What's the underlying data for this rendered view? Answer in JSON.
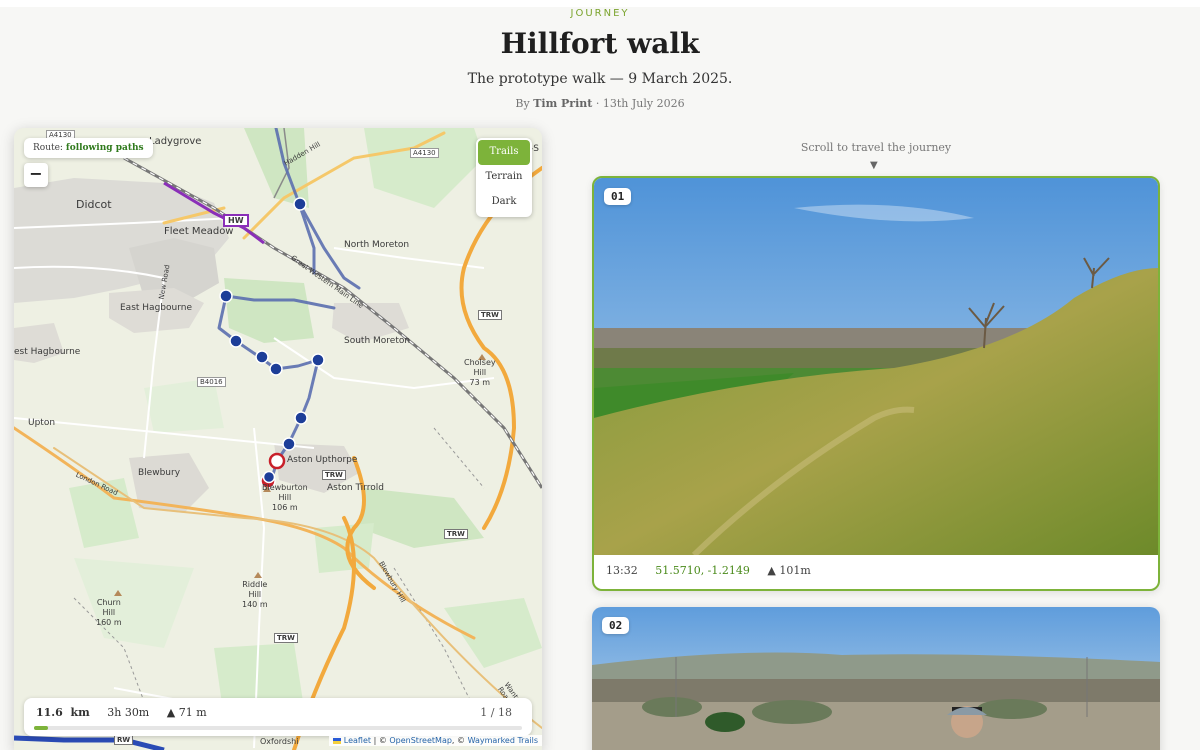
{
  "header": {
    "kicker": "JOURNEY",
    "title": "Hillfort walk",
    "subtitle": "The prototype walk — 9 March 2025.",
    "by_label": "By",
    "author": "Tim Print",
    "date": "· 13th July 2026"
  },
  "map": {
    "route_label": "Route:",
    "route_value": "following paths",
    "zoom_out": "−",
    "layers": [
      {
        "label": "Trails",
        "active": true
      },
      {
        "label": "Terrain",
        "active": false
      },
      {
        "label": "Dark",
        "active": false
      }
    ],
    "places": {
      "ladygrove": "Ladygrove",
      "didcot": "Didcot",
      "fleet_meadow": "Fleet Meadow",
      "north_moreton": "North Moreton",
      "east_hagbourne": "East Hagbourne",
      "west_hagbourne": "est Hagbourne",
      "south_moreton": "South Moreton",
      "cholsey_hill": "Cholsey",
      "cholsey_hill_2": "Hill",
      "cholsey_hill_3": "73 m",
      "upton": "Upton",
      "aston_upthorpe": "Aston Upthorpe",
      "aston_tirrold": "Aston Tirrold",
      "blewbury": "Blewbury",
      "blewburton": "Blewburton",
      "blewburton_2": "Hill",
      "blewburton_3": "106 m",
      "churn_hill": "Churn",
      "churn_hill_2": "Hill",
      "churn_hill_3": "160 m",
      "riddle_hill": "Riddle",
      "riddle_hill_2": "Hill",
      "riddle_hill_3": "140 m",
      "oxfordshire": "Oxfordshi",
      "london_road": "London Road",
      "blewbury_hill": "Blewbury Hill",
      "wantage_road": "Wantage Road",
      "new_road": "New Road",
      "great_western": "Great Western Main Line",
      "hadden_hill": "Hadden Hill",
      "a4130": "A4130",
      "a4130_2": "A4130",
      "b4016": "B4016",
      "hw": "HW",
      "trw_1": "TRW",
      "trw_2": "TRW",
      "trw_3": "TRW",
      "trw_4": "TRW",
      "rw": "RW",
      "s_edge": "-S"
    },
    "stats": {
      "distance": "11.6",
      "distance_unit": "km",
      "duration": "3h 30m",
      "ascent": "▲ 71 m",
      "counter": "1 / 18",
      "progress_fraction": 0.028
    },
    "attribution": {
      "leaflet": "Leaflet",
      "sep1": " | © ",
      "osm": "OpenStreetMap",
      "sep2": ", © ",
      "trails": "Waymarked Trails"
    }
  },
  "journey": {
    "scroll_hint": "Scroll to travel the journey",
    "arrow": "▼",
    "cards": [
      {
        "num": "01",
        "time": "13:32",
        "coords": "51.5710, -1.2149",
        "elevation": "▲ 101m"
      },
      {
        "num": "02"
      }
    ]
  },
  "colors": {
    "accent": "#7db33a",
    "route": "#5b6fb0",
    "waypoint": "#1d3e98",
    "start_marker": "#c8202a"
  }
}
